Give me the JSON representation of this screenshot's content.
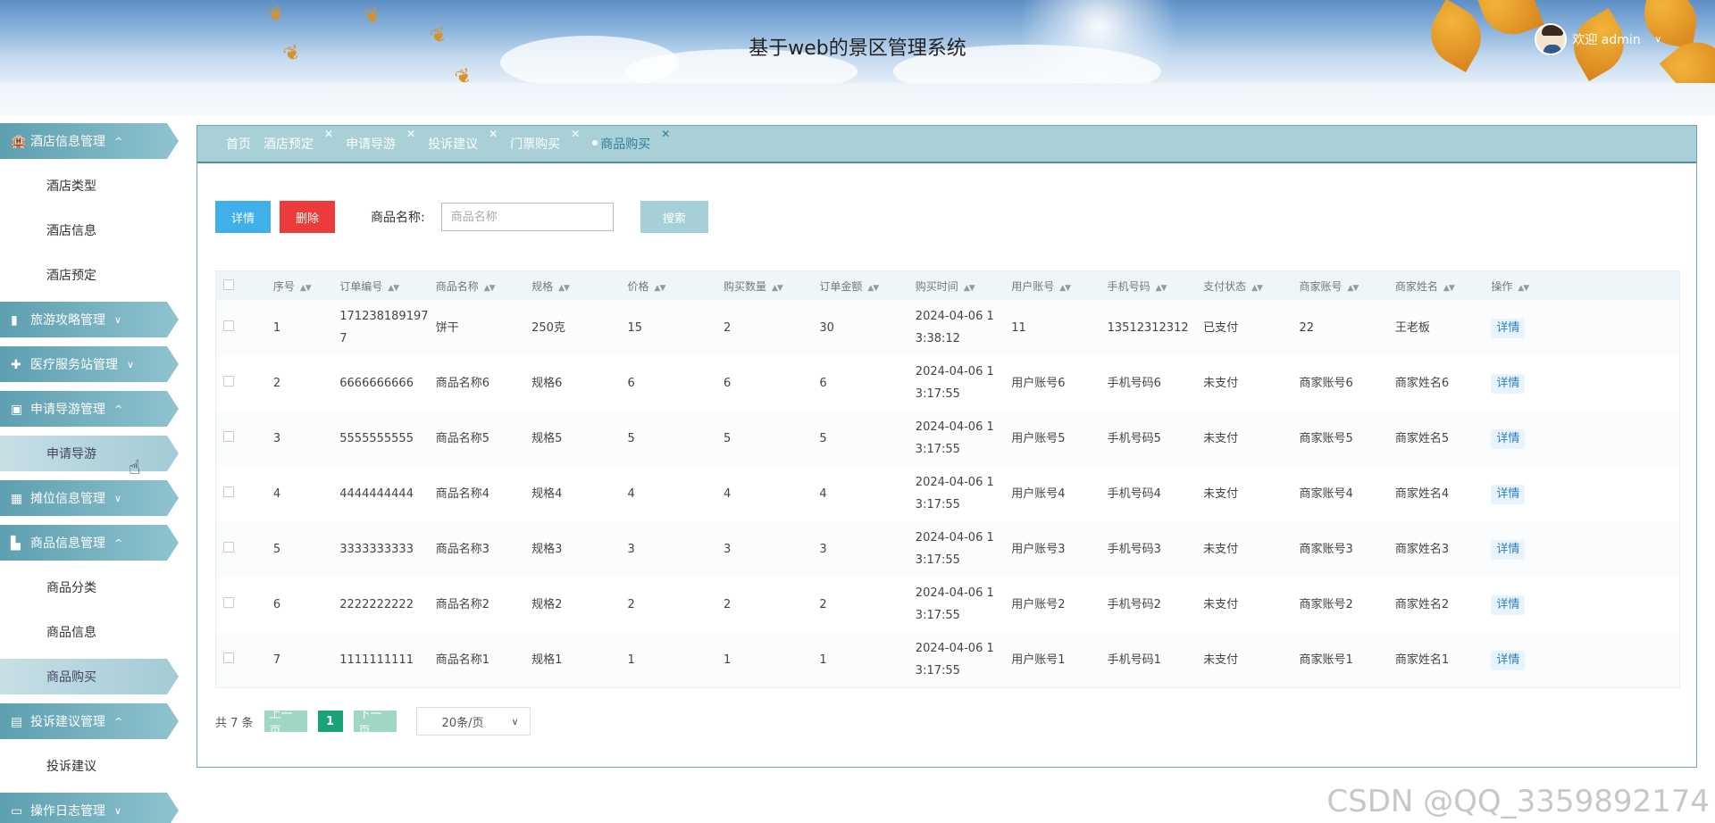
{
  "header": {
    "title": "基于web的景区管理系统",
    "welcome": "欢迎 admin"
  },
  "sidebar": {
    "groups": [
      {
        "label": "酒店信息管理",
        "icon": "hotel-icon",
        "expanded": true,
        "items": [
          "酒店类型",
          "酒店信息",
          "酒店预定"
        ]
      },
      {
        "label": "旅游攻略管理",
        "icon": "chart-icon",
        "expanded": false,
        "items": []
      },
      {
        "label": "医疗服务站管理",
        "icon": "medical-icon",
        "expanded": false,
        "items": []
      },
      {
        "label": "申请导游管理",
        "icon": "briefcase-icon",
        "expanded": true,
        "items": [
          "申请导游"
        ]
      },
      {
        "label": "摊位信息管理",
        "icon": "grid-icon",
        "expanded": false,
        "items": []
      },
      {
        "label": "商品信息管理",
        "icon": "box-icon",
        "expanded": true,
        "items": [
          "商品分类",
          "商品信息",
          "商品购买"
        ]
      },
      {
        "label": "投诉建议管理",
        "icon": "doc-icon",
        "expanded": true,
        "items": [
          "投诉建议"
        ]
      },
      {
        "label": "操作日志管理",
        "icon": "screen-icon",
        "expanded": false,
        "items": []
      }
    ],
    "active_item": "商品购买",
    "hover_item": "申请导游"
  },
  "tabs": [
    {
      "label": "首页",
      "closable": false,
      "active": false
    },
    {
      "label": "酒店预定",
      "closable": true,
      "active": false
    },
    {
      "label": "申请导游",
      "closable": true,
      "active": false
    },
    {
      "label": "投诉建议",
      "closable": true,
      "active": false
    },
    {
      "label": "门票购买",
      "closable": true,
      "active": false
    },
    {
      "label": "商品购买",
      "closable": true,
      "active": true
    }
  ],
  "toolbar": {
    "detail_label": "详情",
    "delete_label": "删除",
    "search_label": "商品名称:",
    "search_placeholder": "商品名称",
    "search_button": "搜索"
  },
  "table": {
    "columns": [
      "序号",
      "订单编号",
      "商品名称",
      "规格",
      "价格",
      "购买数量",
      "订单金额",
      "购买时间",
      "用户账号",
      "手机号码",
      "支付状态",
      "商家账号",
      "商家姓名",
      "操作"
    ],
    "rows": [
      [
        "1",
        "1712381891977",
        "饼干",
        "250克",
        "15",
        "2",
        "30",
        "2024-04-06 13:38:12",
        "11",
        "13512312312",
        "已支付",
        "22",
        "王老板"
      ],
      [
        "2",
        "6666666666",
        "商品名称6",
        "规格6",
        "6",
        "6",
        "6",
        "2024-04-06 13:17:55",
        "用户账号6",
        "手机号码6",
        "未支付",
        "商家账号6",
        "商家姓名6"
      ],
      [
        "3",
        "5555555555",
        "商品名称5",
        "规格5",
        "5",
        "5",
        "5",
        "2024-04-06 13:17:55",
        "用户账号5",
        "手机号码5",
        "未支付",
        "商家账号5",
        "商家姓名5"
      ],
      [
        "4",
        "4444444444",
        "商品名称4",
        "规格4",
        "4",
        "4",
        "4",
        "2024-04-06 13:17:55",
        "用户账号4",
        "手机号码4",
        "未支付",
        "商家账号4",
        "商家姓名4"
      ],
      [
        "5",
        "3333333333",
        "商品名称3",
        "规格3",
        "3",
        "3",
        "3",
        "2024-04-06 13:17:55",
        "用户账号3",
        "手机号码3",
        "未支付",
        "商家账号3",
        "商家姓名3"
      ],
      [
        "6",
        "2222222222",
        "商品名称2",
        "规格2",
        "2",
        "2",
        "2",
        "2024-04-06 13:17:55",
        "用户账号2",
        "手机号码2",
        "未支付",
        "商家账号2",
        "商家姓名2"
      ],
      [
        "7",
        "1111111111",
        "商品名称1",
        "规格1",
        "1",
        "1",
        "1",
        "2024-04-06 13:17:55",
        "用户账号1",
        "手机号码1",
        "未支付",
        "商家账号1",
        "商家姓名1"
      ]
    ],
    "row_action": "详情"
  },
  "pagination": {
    "total": "共 7 条",
    "prev": "上一页",
    "current": "1",
    "next": "下一页",
    "page_size": "20条/页"
  },
  "watermark": "CSDN @QQ_3359892174",
  "colors": {
    "sidebar_accent": "#6aaebd",
    "tab_bar": "#a9d0d7",
    "detail_button": "#3fb0ea",
    "delete_button": "#ec3b3b",
    "page_active": "#1aa37a"
  }
}
